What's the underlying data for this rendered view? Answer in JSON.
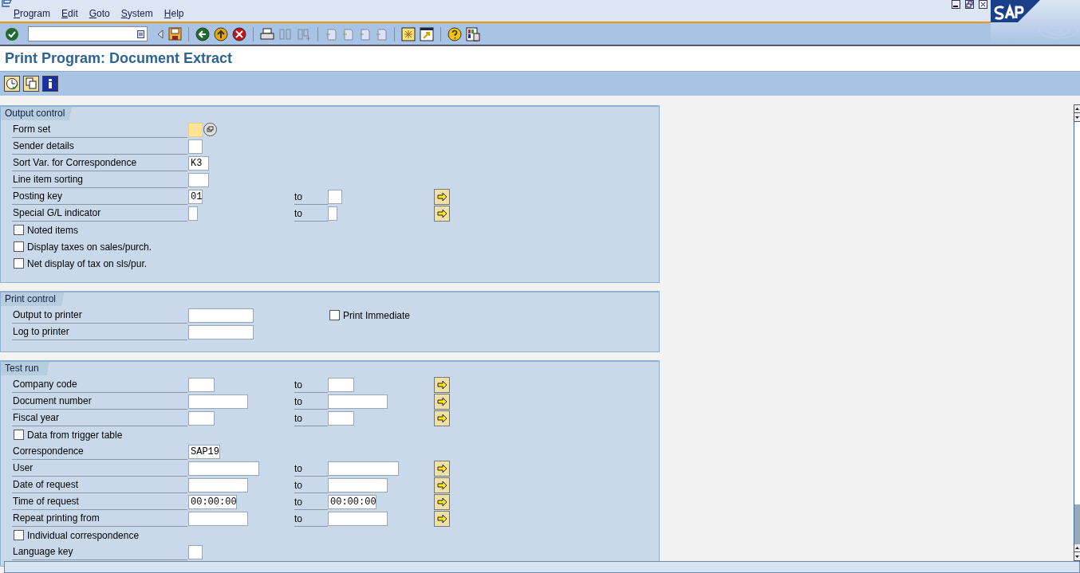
{
  "menu": [
    {
      "label": "Program"
    },
    {
      "label": "Edit"
    },
    {
      "label": "Goto"
    },
    {
      "label": "System"
    },
    {
      "label": "Help"
    }
  ],
  "title": "Print Program: Document Extract",
  "sections": [
    {
      "title": "Output control",
      "rows": [
        {
          "kind": "help_field",
          "label": "Form set",
          "value": "",
          "focused": true
        },
        {
          "kind": "field",
          "label": "Sender details",
          "value": "",
          "focused": false
        },
        {
          "kind": "field",
          "label": "Sort Var. for Correspondence",
          "value": "K3",
          "focused": false
        },
        {
          "kind": "field",
          "label": "Line item sorting",
          "value": "",
          "focused": false
        },
        {
          "kind": "range",
          "label": "Posting key",
          "value": "01",
          "focused": false,
          "to_label": "to",
          "to_value": ""
        },
        {
          "kind": "range",
          "label": "Special G/L indicator",
          "value": "",
          "focused": false,
          "to_label": "to",
          "to_value": ""
        },
        {
          "kind": "checkbox",
          "label": "Noted items",
          "checked": false
        },
        {
          "kind": "checkbox",
          "label": "Display taxes on sales/purch.",
          "checked": false
        },
        {
          "kind": "checkbox",
          "label": "Net display of tax on sls/pur.",
          "checked": false
        }
      ]
    },
    {
      "title": "Print control",
      "rows": [
        {
          "kind": "field",
          "label": "Output to printer",
          "value": "",
          "focused": false,
          "side_checkbox": {
            "label": "Print Immediate",
            "checked": false
          }
        },
        {
          "kind": "field",
          "label": "Log to printer",
          "value": "",
          "focused": false
        }
      ]
    },
    {
      "title": "Test run",
      "rows": [
        {
          "kind": "range",
          "label": "Company code",
          "value": "",
          "focused": false,
          "to_label": "to",
          "to_value": ""
        },
        {
          "kind": "range",
          "label": "Document number",
          "value": "",
          "focused": false,
          "to_label": "to",
          "to_value": ""
        },
        {
          "kind": "range",
          "label": "Fiscal year",
          "value": "",
          "focused": false,
          "to_label": "to",
          "to_value": ""
        },
        {
          "kind": "checkbox",
          "label": "Data from trigger table",
          "checked": false
        },
        {
          "kind": "field",
          "label": "Correspondence",
          "value": "SAP19",
          "focused": false
        },
        {
          "kind": "range",
          "label": "User",
          "value": "",
          "focused": false,
          "to_label": "to",
          "to_value": ""
        },
        {
          "kind": "range",
          "label": "Date of request",
          "value": "",
          "focused": false,
          "to_label": "to",
          "to_value": ""
        },
        {
          "kind": "range",
          "label": "Time of request",
          "value": "00:00:00",
          "focused": false,
          "to_label": "to",
          "to_value": "00:00:00"
        },
        {
          "kind": "range",
          "label": "Repeat printing from",
          "value": "",
          "focused": false,
          "to_label": "to",
          "to_value": ""
        },
        {
          "kind": "checkbox",
          "label": "Individual correspondence",
          "checked": false
        },
        {
          "kind": "field",
          "label": "Language key",
          "value": "",
          "focused": false
        }
      ]
    }
  ]
}
